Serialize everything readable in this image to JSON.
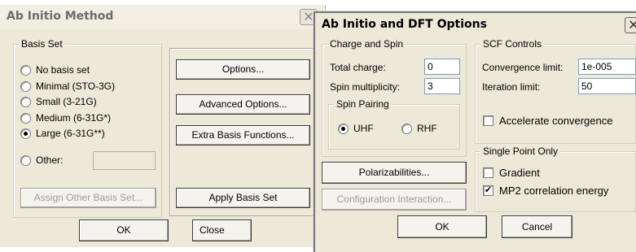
{
  "method_dialog": {
    "title": "Ab Initio Method",
    "close_glyph": "✕",
    "basis_set": {
      "legend": "Basis Set",
      "options": [
        {
          "label": "No basis set",
          "checked": false
        },
        {
          "label": "Minimal (STO-3G)",
          "checked": false
        },
        {
          "label": "Small (3-21G)",
          "checked": false
        },
        {
          "label": "Medium (6-31G*)",
          "checked": false
        },
        {
          "label": "Large (6-31G**)",
          "checked": true
        },
        {
          "label": "Other:",
          "checked": false
        }
      ],
      "other_value": "",
      "assign_button": "Assign Other Basis Set..."
    },
    "buttons": {
      "options": "Options...",
      "advanced": "Advanced Options...",
      "extra_basis": "Extra Basis Functions...",
      "apply_basis": "Apply Basis Set",
      "ok": "OK",
      "close": "Close"
    }
  },
  "dft_dialog": {
    "title": "Ab Initio and DFT Options",
    "close_glyph": "✕",
    "charge_spin": {
      "legend": "Charge and Spin",
      "total_charge_label": "Total charge:",
      "total_charge_value": "0",
      "spin_mult_label": "Spin multiplicity:",
      "spin_mult_value": "3",
      "spin_pairing": {
        "legend": "Spin Pairing",
        "uhf": "UHF",
        "rhf": "RHF",
        "selected": "UHF"
      }
    },
    "scf_controls": {
      "legend": "SCF Controls",
      "convergence_label": "Convergence limit:",
      "convergence_value": "1e-005",
      "iteration_label": "Iteration limit:",
      "iteration_value": "50",
      "accelerate_label": "Accelerate convergence",
      "accelerate_checked": false
    },
    "single_point": {
      "legend": "Single Point Only",
      "gradient_label": "Gradient",
      "gradient_checked": false,
      "mp2_label": "MP2 correlation energy",
      "mp2_checked": true
    },
    "buttons": {
      "polarizabilities": "Polarizabilities...",
      "configuration": "Configuration Interaction...",
      "ok": "OK",
      "cancel": "Cancel"
    }
  },
  "colors": {
    "dialog_face": "#ece9d8",
    "disabled_text": "#9d9d9d"
  }
}
